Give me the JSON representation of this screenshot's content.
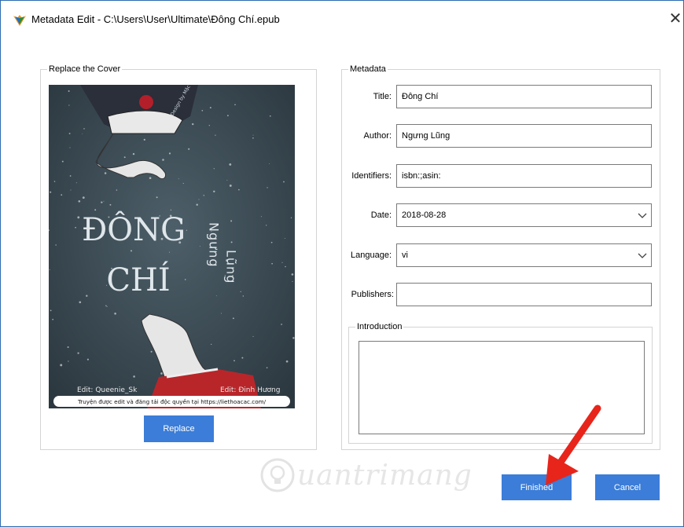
{
  "window": {
    "title": "Metadata Edit - C:\\Users\\User\\Ultimate\\Đông Chí.epub",
    "close_glyph": "✕"
  },
  "cover_section": {
    "legend": "Replace the Cover",
    "replace_label": "Replace",
    "cover_text": {
      "title_line1": "ĐÔNG",
      "title_line2": "CHÍ",
      "author_vertical_1": "Ngưng",
      "author_vertical_2": "Lũng",
      "credit_left": "Edit: Queenie_Sk",
      "credit_right": "Edit: Đinh Hương",
      "banner": "Truyện được edit và đăng tải độc quyền tại https://liethoacac.com/",
      "corner_sign": "Design by Mặc Tĩnh"
    }
  },
  "metadata": {
    "legend": "Metadata",
    "title_label": "Title:",
    "title_value": "Đông Chí",
    "author_label": "Author:",
    "author_value": "Ngưng Lũng",
    "identifiers_label": "Identifiers:",
    "identifiers_value": "isbn:;asin:",
    "date_label": "Date:",
    "date_value": "2018-08-28",
    "language_label": "Language:",
    "language_value": "vi",
    "publishers_label": "Publishers:",
    "publishers_value": "",
    "introduction_legend": "Introduction",
    "introduction_value": ""
  },
  "footer": {
    "finished_label": "Finished",
    "cancel_label": "Cancel"
  },
  "watermark": {
    "text": "uantrimang"
  },
  "colors": {
    "button_blue": "#3b7dd8",
    "arrow_red": "#e8251b",
    "cover_bg": "#3a4a53"
  },
  "icons": {
    "app": "app-logo-icon",
    "close": "close-icon",
    "dropdown": "chevron-down-icon",
    "arrow": "red-arrow-annotation"
  }
}
